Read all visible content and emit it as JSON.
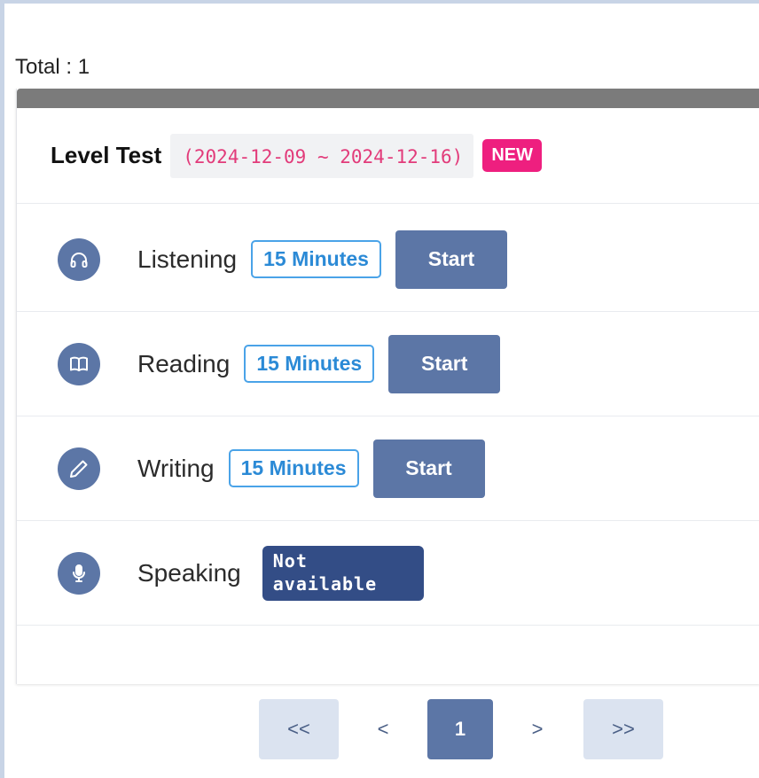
{
  "total_text": "Total : 1",
  "test": {
    "title": "Level Test",
    "date_range": "(2024-12-09 ~ 2024-12-16)",
    "badge": "NEW"
  },
  "sections": [
    {
      "label": "Listening",
      "duration": "15 Minutes",
      "action": "Start",
      "icon": "headphones-icon"
    },
    {
      "label": "Reading",
      "duration": "15 Minutes",
      "action": "Start",
      "icon": "book-icon"
    },
    {
      "label": "Writing",
      "duration": "15 Minutes",
      "action": "Start",
      "icon": "pencil-icon"
    },
    {
      "label": "Speaking",
      "status": "Not available",
      "icon": "microphone-icon"
    }
  ],
  "pagination": {
    "first": "<<",
    "prev": "<",
    "current": "1",
    "next": ">",
    "last": ">>"
  },
  "colors": {
    "accent": "#5c76a6",
    "badge_new": "#ee1f7f",
    "date_text": "#e23b7a",
    "duration_border": "#4aa3e8",
    "not_available_bg": "#334d86"
  }
}
